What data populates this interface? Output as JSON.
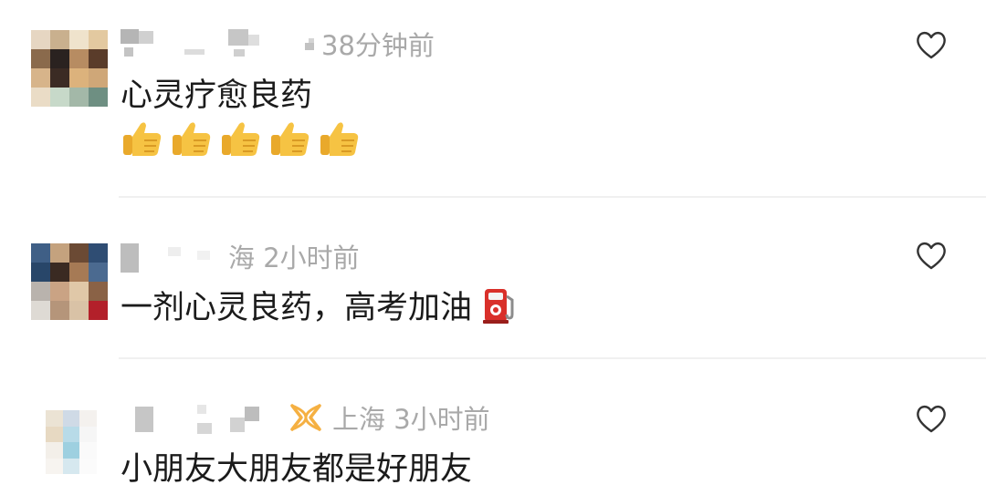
{
  "colors": {
    "text": "#1b1b1b",
    "meta": "#a9a9a9",
    "divider": "#f0f0f0",
    "badge": "#f5b042",
    "thumb": "#f6c343",
    "pump": "#d9302a"
  },
  "comments": [
    {
      "time": "38分钟前",
      "text": "心灵疗愈良药",
      "emoji": [
        "thumbs-up",
        "thumbs-up",
        "thumbs-up",
        "thumbs-up",
        "thumbs-up"
      ],
      "like_icon": "heart-outline-icon"
    },
    {
      "location_time": "海 2小时前",
      "text": "一剂心灵良药，高考加油",
      "emoji": [
        "fuel-pump"
      ],
      "like_icon": "heart-outline-icon"
    },
    {
      "location_time": "上海 3小时前",
      "text": "小朋友大朋友都是好朋友",
      "badge_icon": "fan-badge-icon",
      "like_icon": "heart-outline-icon"
    }
  ]
}
